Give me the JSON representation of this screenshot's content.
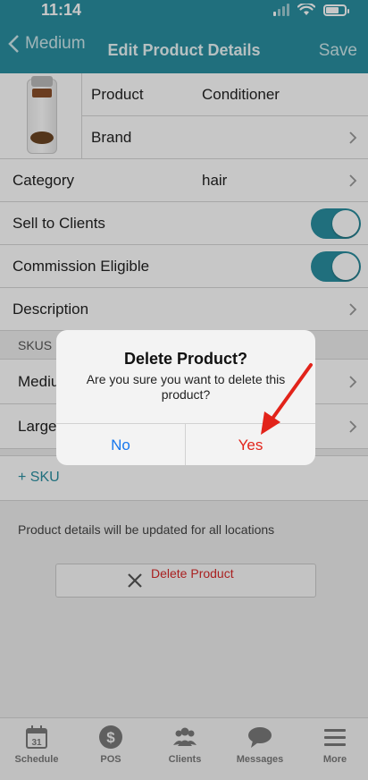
{
  "status": {
    "time": "11:14"
  },
  "nav": {
    "back_label": "Medium",
    "title": "Edit Product Details",
    "save_label": "Save"
  },
  "product": {
    "product_label": "Product",
    "product_value": "Conditioner",
    "brand_label": "Brand"
  },
  "fields": {
    "category_label": "Category",
    "category_value": "hair",
    "sell_label": "Sell to Clients",
    "sell_on": true,
    "commission_label": "Commission Eligible",
    "commission_on": true,
    "description_label": "Description"
  },
  "skus": {
    "header": "SKUS",
    "items": [
      "Medium",
      "Large"
    ],
    "add_label": "+ SKU"
  },
  "note": "Product details will be updated for all locations",
  "delete_label": "Delete Product",
  "tabs": [
    {
      "label": "Schedule",
      "icon": "calendar-icon",
      "badge": "31"
    },
    {
      "label": "POS",
      "icon": "dollar-icon"
    },
    {
      "label": "Clients",
      "icon": "people-icon"
    },
    {
      "label": "Messages",
      "icon": "chat-icon"
    },
    {
      "label": "More",
      "icon": "menu-icon"
    }
  ],
  "dialog": {
    "title": "Delete Product?",
    "message": "Are you sure you want to delete this product?",
    "no_label": "No",
    "yes_label": "Yes"
  },
  "colors": {
    "accent": "#2a8fa0",
    "danger": "#e2231a",
    "link": "#1677ee"
  }
}
